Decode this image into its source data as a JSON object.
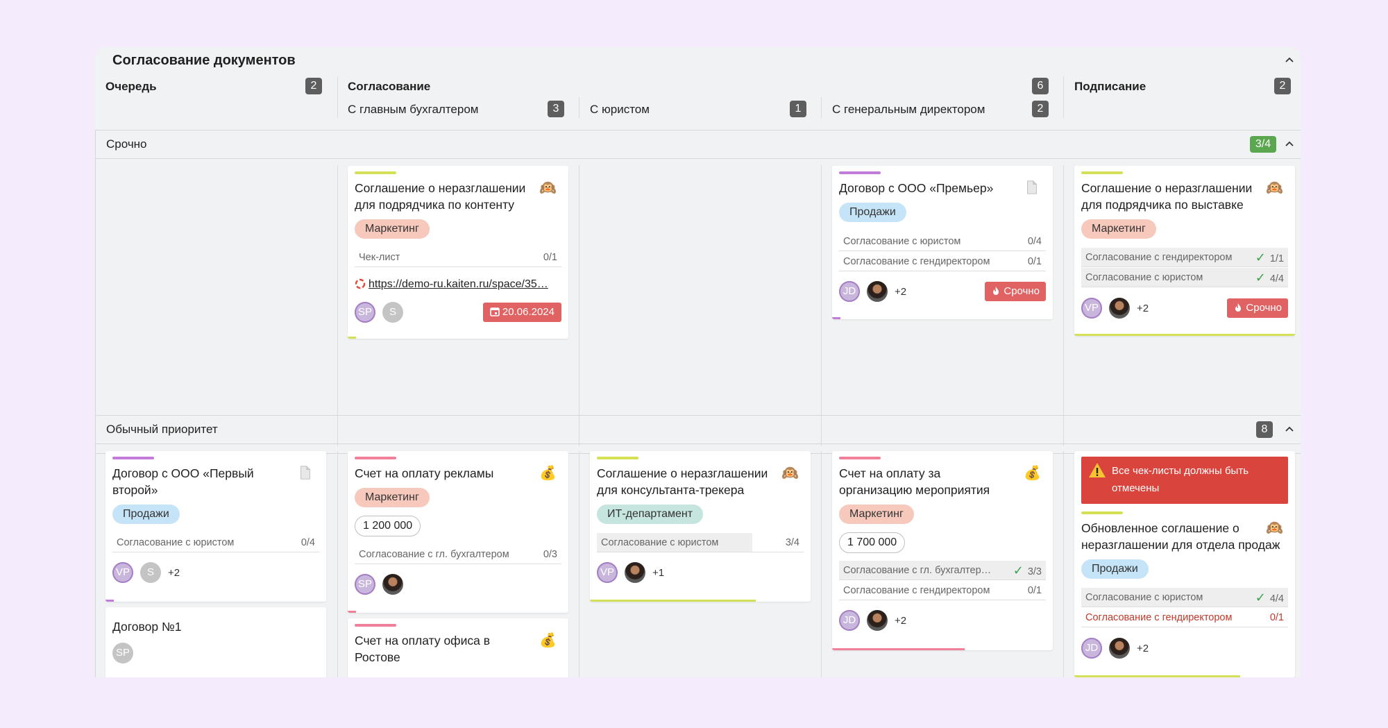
{
  "board": {
    "title": "Согласование документов",
    "columns": [
      {
        "title": "Очередь",
        "count": "2"
      },
      {
        "title": "Согласование",
        "count": "6",
        "subcolumns": [
          {
            "title": "С главным бухгалтером",
            "count": "3"
          },
          {
            "title": "С юристом",
            "count": "1"
          },
          {
            "title": "С генеральным директором",
            "count": "2"
          }
        ]
      },
      {
        "title": "Подписание",
        "count": "2"
      }
    ]
  },
  "lanes": [
    {
      "title": "Срочно",
      "count": "3/4"
    },
    {
      "title": "Обычный приоритет",
      "count": "8"
    }
  ],
  "cards": {
    "u1": {
      "title": "Соглашение о неразглашении для подрядчика по контенту",
      "icon": "monkey-icon",
      "tag": "Маркетинг",
      "checklist": [
        {
          "label": "Чек-лист",
          "value": "0/1"
        }
      ],
      "link": "https://demo-ru.kaiten.ru/space/35…",
      "avatars": [
        "SP",
        "S"
      ],
      "date": "20.06.2024",
      "stripe_color": "#d4e157"
    },
    "u2": {
      "title": "Договор с ООО «Премьер»",
      "icon": "document-icon",
      "tag": "Продажи",
      "checklist": [
        {
          "label": "Согласование с юристом",
          "value": "0/4"
        },
        {
          "label": "Согласование с гендиректором",
          "value": "0/1"
        }
      ],
      "avatars": [
        "JD"
      ],
      "more": "+2",
      "badge": "Срочно",
      "stripe_color": "#c27bd8"
    },
    "u3": {
      "title": "Соглашение о неразглашении для подрядчика по выставке",
      "icon": "monkey-icon",
      "tag": "Маркетинг",
      "checklist": [
        {
          "label": "Согласование с гендиректором",
          "value": "1/1"
        },
        {
          "label": "Согласование с юристом",
          "value": "4/4"
        }
      ],
      "avatars": [
        "VP"
      ],
      "more": "+2",
      "badge": "Срочно",
      "stripe_color": "#d4e157"
    },
    "n1": {
      "title": "Договор с ООО «Первый второй»",
      "icon": "document-icon",
      "tag": "Продажи",
      "checklist": [
        {
          "label": "Согласование с юристом",
          "value": "0/4"
        }
      ],
      "avatars": [
        "VP",
        "S"
      ],
      "more": "+2",
      "stripe_color": "#c27bd8"
    },
    "n2": {
      "title": "Договор №1",
      "avatars": [
        "SP"
      ]
    },
    "n3": {
      "title": "Счет на оплату рекламы",
      "icon": "money-bag-icon",
      "tag": "Маркетинг",
      "amount": "1 200 000",
      "checklist": [
        {
          "label": "Согласование с гл. бухгалтером",
          "value": "0/3"
        }
      ],
      "avatars": [
        "SP"
      ],
      "stripe_color": "#f0809a"
    },
    "n4": {
      "title": "Счет на оплату офиса в Ростове",
      "icon": "money-bag-icon",
      "stripe_color": "#f0809a"
    },
    "n5": {
      "title": "Соглашение о неразглашении для консультанта-трекера",
      "icon": "monkey-icon",
      "tag": "ИТ-департамент",
      "checklist": [
        {
          "label": "Согласование с юристом",
          "value": "3/4"
        }
      ],
      "avatars": [
        "VP"
      ],
      "more": "+1",
      "stripe_color": "#d4e157"
    },
    "n6": {
      "title": "Счет на оплату за организацию мероприятия",
      "icon": "money-bag-icon",
      "tag": "Маркетинг",
      "amount": "1 700 000",
      "checklist": [
        {
          "label": "Согласование с гл. бухгалтер…",
          "value": "3/3"
        },
        {
          "label": "Согласование с гендиректором",
          "value": "0/1"
        }
      ],
      "avatars": [
        "JD"
      ],
      "more": "+2",
      "stripe_color": "#f0809a"
    },
    "n7": {
      "alert": "Все чек-листы должны быть отмечены",
      "title": "Обновленное соглашение о неразглашении для отдела продаж",
      "icon": "monkey-icon",
      "tag": "Продажи",
      "checklist": [
        {
          "label": "Согласование с юристом",
          "value": "4/4"
        },
        {
          "label": "Согласование с гендиректором",
          "value": "0/1"
        }
      ],
      "avatars": [
        "JD"
      ],
      "more": "+2",
      "stripe_color": "#d4e157"
    }
  },
  "colors": {
    "accent_green": "#5aa74f",
    "urgent_red": "#e06262",
    "alert_red": "#d9443d",
    "progress_green": "#d4e157",
    "progress_pink": "#f0809a",
    "progress_purple": "#c27bd8"
  }
}
